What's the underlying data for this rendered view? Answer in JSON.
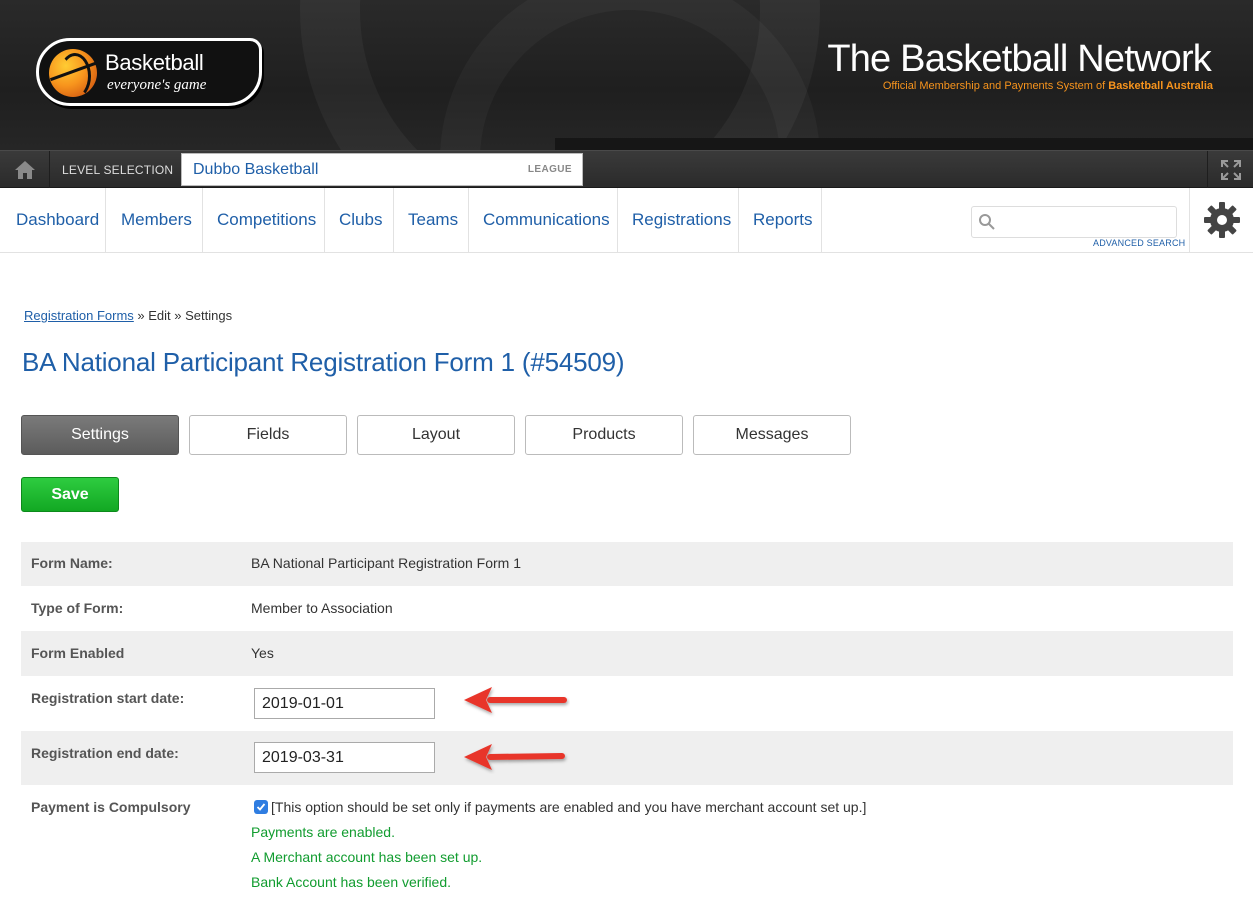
{
  "header": {
    "logo_line1": "Basketball",
    "logo_line2": "everyone's game",
    "brand_title": "The Basketball Network",
    "brand_subtitle_prefix": "Official Membership and Payments System of ",
    "brand_subtitle_org": "Basketball Australia",
    "accent_color": "#f7941d"
  },
  "level_bar": {
    "home_icon": "home-icon",
    "label": "LEVEL SELECTION",
    "level_name": "Dubbo Basketball",
    "level_type": "LEAGUE",
    "expand_icon": "expand-icon"
  },
  "nav": {
    "items": [
      {
        "label": "Dashboard"
      },
      {
        "label": "Members"
      },
      {
        "label": "Competitions"
      },
      {
        "label": "Clubs"
      },
      {
        "label": "Teams"
      },
      {
        "label": "Communications"
      },
      {
        "label": "Registrations"
      },
      {
        "label": "Reports"
      }
    ],
    "search_placeholder": "",
    "advanced_search": "ADVANCED SEARCH",
    "link_color": "#1f5fa8"
  },
  "breadcrumb": {
    "link": "Registration Forms",
    "rest": " » Edit » Settings"
  },
  "page_title": "BA National Participant Registration Form 1 (#54509)",
  "tabs": [
    {
      "label": "Settings",
      "active": true
    },
    {
      "label": "Fields"
    },
    {
      "label": "Layout"
    },
    {
      "label": "Products"
    },
    {
      "label": "Messages"
    }
  ],
  "save_label": "Save",
  "form": {
    "form_name_label": "Form Name:",
    "form_name_value": "BA National Participant Registration Form 1",
    "type_label": "Type of Form:",
    "type_value": "Member to Association",
    "enabled_label": "Form Enabled",
    "enabled_value": "Yes",
    "start_label": "Registration start date:",
    "start_value": "2019-01-01",
    "end_label": "Registration end date:",
    "end_value": "2019-03-31",
    "payment_label": "Payment is Compulsory",
    "payment_checked": true,
    "payment_note": "[This option should be set only if payments are enabled and you have merchant account set up.]",
    "status_payments": "Payments are enabled.",
    "status_merchant": "A Merchant account has been set up.",
    "status_bank": "Bank Account has been verified.",
    "status_color": "#119c2f"
  }
}
